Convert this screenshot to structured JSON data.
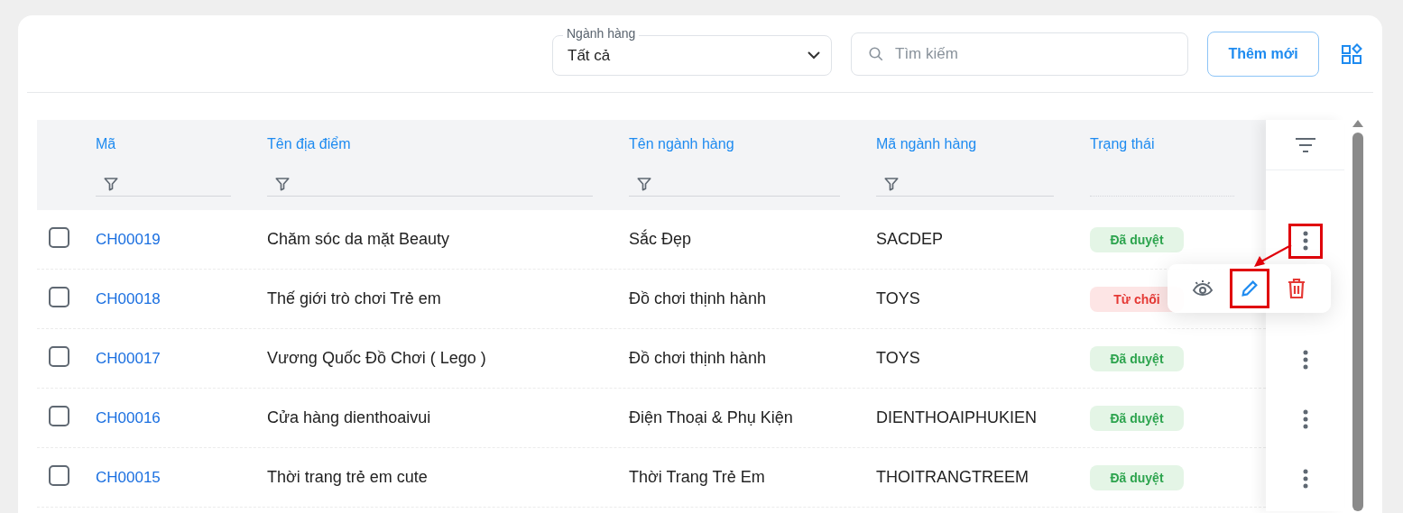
{
  "toolbar": {
    "category_filter": {
      "label": "Ngành hàng",
      "value": "Tất cả"
    },
    "search": {
      "placeholder": "Tìm kiếm"
    },
    "add_button": "Thêm mới"
  },
  "table": {
    "columns": [
      {
        "label": "Mã",
        "filter": true
      },
      {
        "label": "Tên địa điểm",
        "filter": true
      },
      {
        "label": "Tên ngành hàng",
        "filter": true
      },
      {
        "label": "Mã ngành hàng",
        "filter": true
      },
      {
        "label": "Trạng thái",
        "filter": false
      }
    ],
    "rows": [
      {
        "checked": false,
        "code": "CH00019",
        "name": "Chăm sóc da mặt Beauty",
        "category": "Sắc Đẹp",
        "category_code": "SACDEP",
        "status": {
          "label": "Đã duyệt",
          "kind": "approved"
        }
      },
      {
        "checked": false,
        "code": "CH00018",
        "name": "Thế giới trò chơi Trẻ em",
        "category": "Đồ chơi thịnh hành",
        "category_code": "TOYS",
        "status": {
          "label": "Từ chối",
          "kind": "rejected"
        }
      },
      {
        "checked": false,
        "code": "CH00017",
        "name": "Vương Quốc Đồ Chơi ( Lego )",
        "category": "Đồ chơi thịnh hành",
        "category_code": "TOYS",
        "status": {
          "label": "Đã duyệt",
          "kind": "approved"
        }
      },
      {
        "checked": false,
        "code": "CH00016",
        "name": "Cửa hàng dienthoaivui",
        "category": "Điện Thoại & Phụ Kiện",
        "category_code": "DIENTHOAIPHUKIEN",
        "status": {
          "label": "Đã duyệt",
          "kind": "approved"
        }
      },
      {
        "checked": false,
        "code": "CH00015",
        "name": "Thời trang trẻ em cute",
        "category": "Thời Trang Trẻ Em",
        "category_code": "THOITRANGTREEM",
        "status": {
          "label": "Đã duyệt",
          "kind": "approved"
        }
      }
    ]
  },
  "action_menu": {
    "open": true
  },
  "highlights": {
    "menu_button": true,
    "edit_button": true
  }
}
